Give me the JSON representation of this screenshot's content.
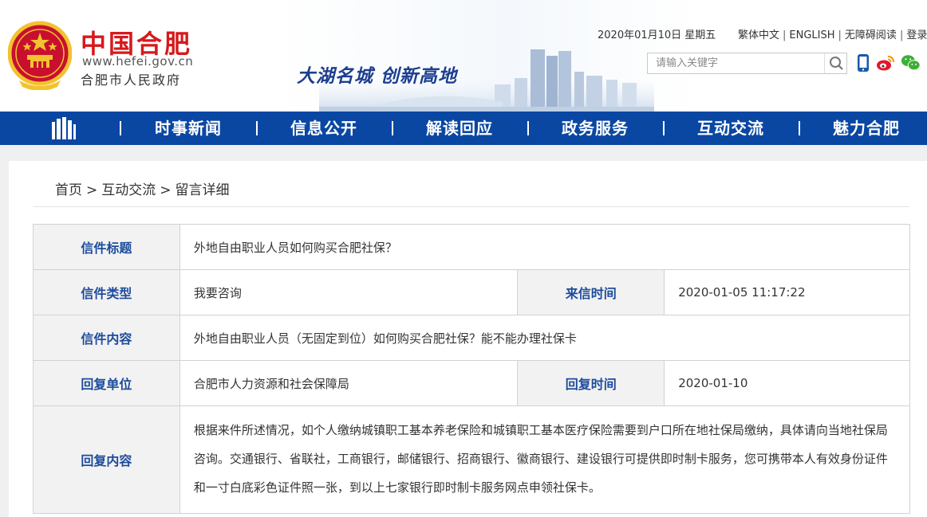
{
  "header": {
    "logo_title": "中国合肥",
    "logo_url": "www.hefei.gov.cn",
    "logo_subtitle": "合肥市人民政府",
    "slogan": "大湖名城  创新高地",
    "date": "2020年01月10日 星期五",
    "links": [
      "繁体中文",
      "ENGLISH",
      "无障碍阅读",
      "登录"
    ],
    "search": {
      "placeholder": "请输入关键字"
    },
    "icons": [
      "search-icon",
      "mobile-icon",
      "weibo-icon",
      "wechat-icon"
    ],
    "colors": {
      "brand_red": "#d7191c",
      "nav_blue": "#0a47a3",
      "label_blue": "#1d4c9c"
    }
  },
  "nav": {
    "home_icon": "building-icon",
    "items": [
      "时事新闻",
      "信息公开",
      "解读回应",
      "政务服务",
      "互动交流",
      "魅力合肥"
    ]
  },
  "breadcrumb": [
    "首页",
    "互动交流",
    "留言详细"
  ],
  "detail": {
    "title_label": "信件标题",
    "title_value": "外地自由职业人员如何购买合肥社保？",
    "type_label": "信件类型",
    "type_value": "我要咨询",
    "time_label": "来信时间",
    "time_value": "2020-01-05 11:17:22",
    "content_label": "信件内容",
    "content_value": "外地自由职业人员（无固定到位）如何购买合肥社保？能不能办理社保卡",
    "unit_label": "回复单位",
    "unit_value": "合肥市人力资源和社会保障局",
    "reply_time_label": "回复时间",
    "reply_time_value": "2020-01-10",
    "reply_label": "回复内容",
    "reply_value": "根据来件所述情况，如个人缴纳城镇职工基本养老保险和城镇职工基本医疗保险需要到户口所在地社保局缴纳，具体请向当地社保局咨询。交通银行、省联社，工商银行，邮储银行、招商银行、徽商银行、建设银行可提供即时制卡服务，您可携带本人有效身份证件和一寸白底彩色证件照一张，到以上七家银行即时制卡服务网点申领社保卡。"
  }
}
